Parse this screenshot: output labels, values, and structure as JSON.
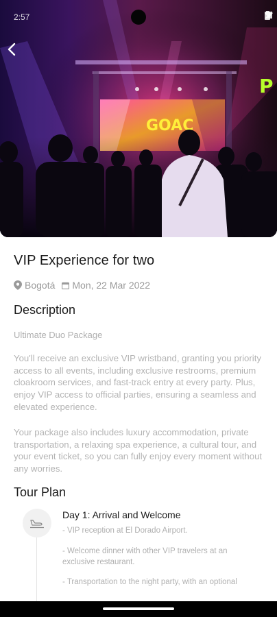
{
  "status_bar": {
    "time": "2:57"
  },
  "hero": {
    "screen_text": "GOAC",
    "side_text": "P"
  },
  "event": {
    "title": "VIP Experience for two",
    "location": "Bogotá",
    "date": "Mon, 22 Mar 2022"
  },
  "description": {
    "heading": "Description",
    "subtitle": "Ultimate Duo Package",
    "paragraph1": "You'll receive an exclusive VIP wristband, granting you priority access to all events, including exclusive restrooms, premium cloakroom services, and fast-track entry at every party. Plus, enjoy VIP access to official parties, ensuring a seamless and elevated experience.",
    "paragraph2": "Your package also includes luxury accommodation, private transportation, a relaxing spa experience, a cultural tour, and your event ticket, so you can fully enjoy every moment without any worries."
  },
  "tour_plan": {
    "heading": "Tour Plan",
    "days": [
      {
        "title": "Day 1: Arrival and Welcome",
        "icon": "airplane-landing-icon",
        "lines": [
          "- VIP reception at El Dorado Airport.",
          "- Welcome dinner with other VIP travelers at an exclusive restaurant.",
          "- Transportation to the night party, with an optional"
        ]
      }
    ]
  },
  "colors": {
    "text_primary": "#1a1a1a",
    "text_secondary": "#9a9a9a",
    "text_muted": "#b3b3b3",
    "hero_bg": "#120a2a"
  }
}
